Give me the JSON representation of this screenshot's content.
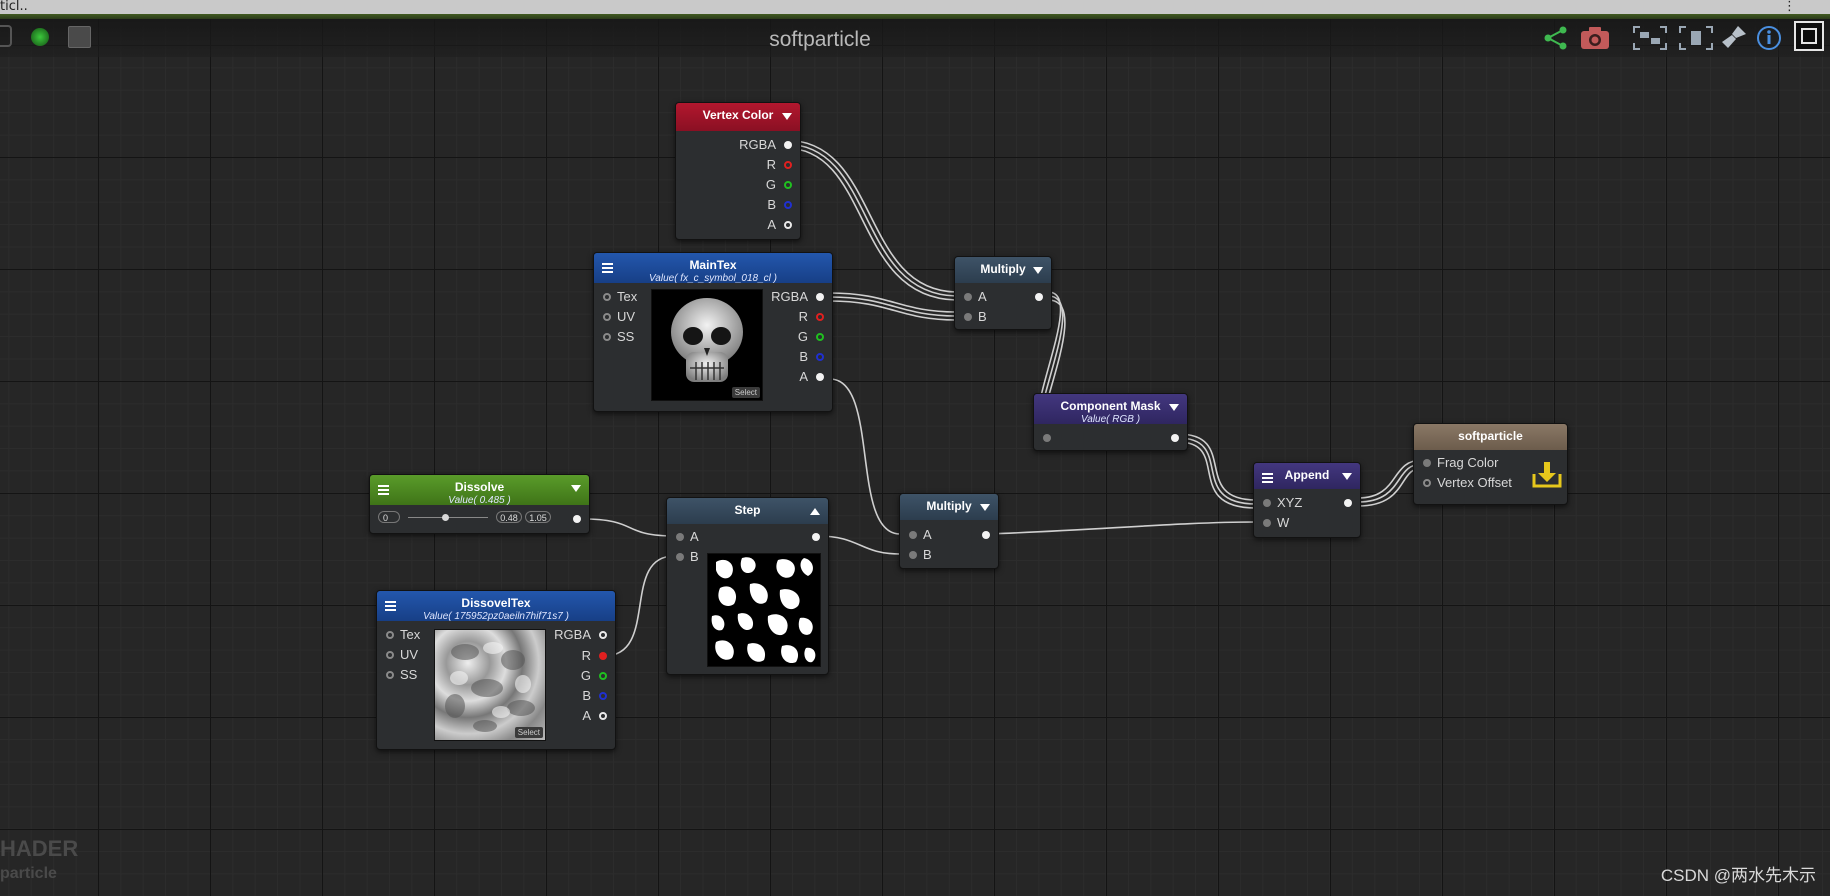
{
  "window": {
    "title_fragment": "ticl..",
    "trailing": "⋮"
  },
  "header": {
    "title": "softparticle"
  },
  "nodes": {
    "vertex_color": {
      "title": "Vertex Color",
      "outputs": [
        "RGBA",
        "R",
        "G",
        "B",
        "A"
      ]
    },
    "maintex": {
      "title": "MainTex",
      "subtitle": "Value( fx_c_symbol_018_cl )",
      "inputs": [
        "Tex",
        "UV",
        "SS"
      ],
      "outputs": [
        "RGBA",
        "R",
        "G",
        "B",
        "A"
      ],
      "select": "Select"
    },
    "multiply1": {
      "title": "Multiply",
      "inputs": [
        "A",
        "B"
      ]
    },
    "component_mask": {
      "title": "Component Mask",
      "subtitle": "Value( RGB )"
    },
    "dissolve": {
      "title": "Dissolve",
      "subtitle": "Value( 0.485 )",
      "min": "0",
      "value": "0.48",
      "max": "1.05",
      "slider_fraction": 0.46
    },
    "step": {
      "title": "Step",
      "inputs": [
        "A",
        "B"
      ]
    },
    "multiply2": {
      "title": "Multiply",
      "inputs": [
        "A",
        "B"
      ]
    },
    "append": {
      "title": "Append",
      "inputs": [
        "XYZ",
        "W"
      ]
    },
    "dissoveltex": {
      "title": "DissovelTex",
      "subtitle": "Value( 175952pz0aeiln7hif71s7 )",
      "inputs": [
        "Tex",
        "UV",
        "SS"
      ],
      "outputs": [
        "RGBA",
        "R",
        "G",
        "B",
        "A"
      ],
      "select": "Select"
    },
    "output": {
      "title": "softparticle",
      "inputs": [
        "Frag Color",
        "Vertex Offset"
      ]
    }
  },
  "footer": {
    "logo_line1": "HADER",
    "logo_line2": "particle",
    "watermark": "CSDN @两水先木示"
  },
  "colors": {
    "vertex_color": "#a5142a",
    "tex_node": "#1d4a93",
    "math_node": "#35485a",
    "mask_node": "#3a2f72",
    "dissolve": "#4e8a22",
    "output": "#7b6a58"
  }
}
